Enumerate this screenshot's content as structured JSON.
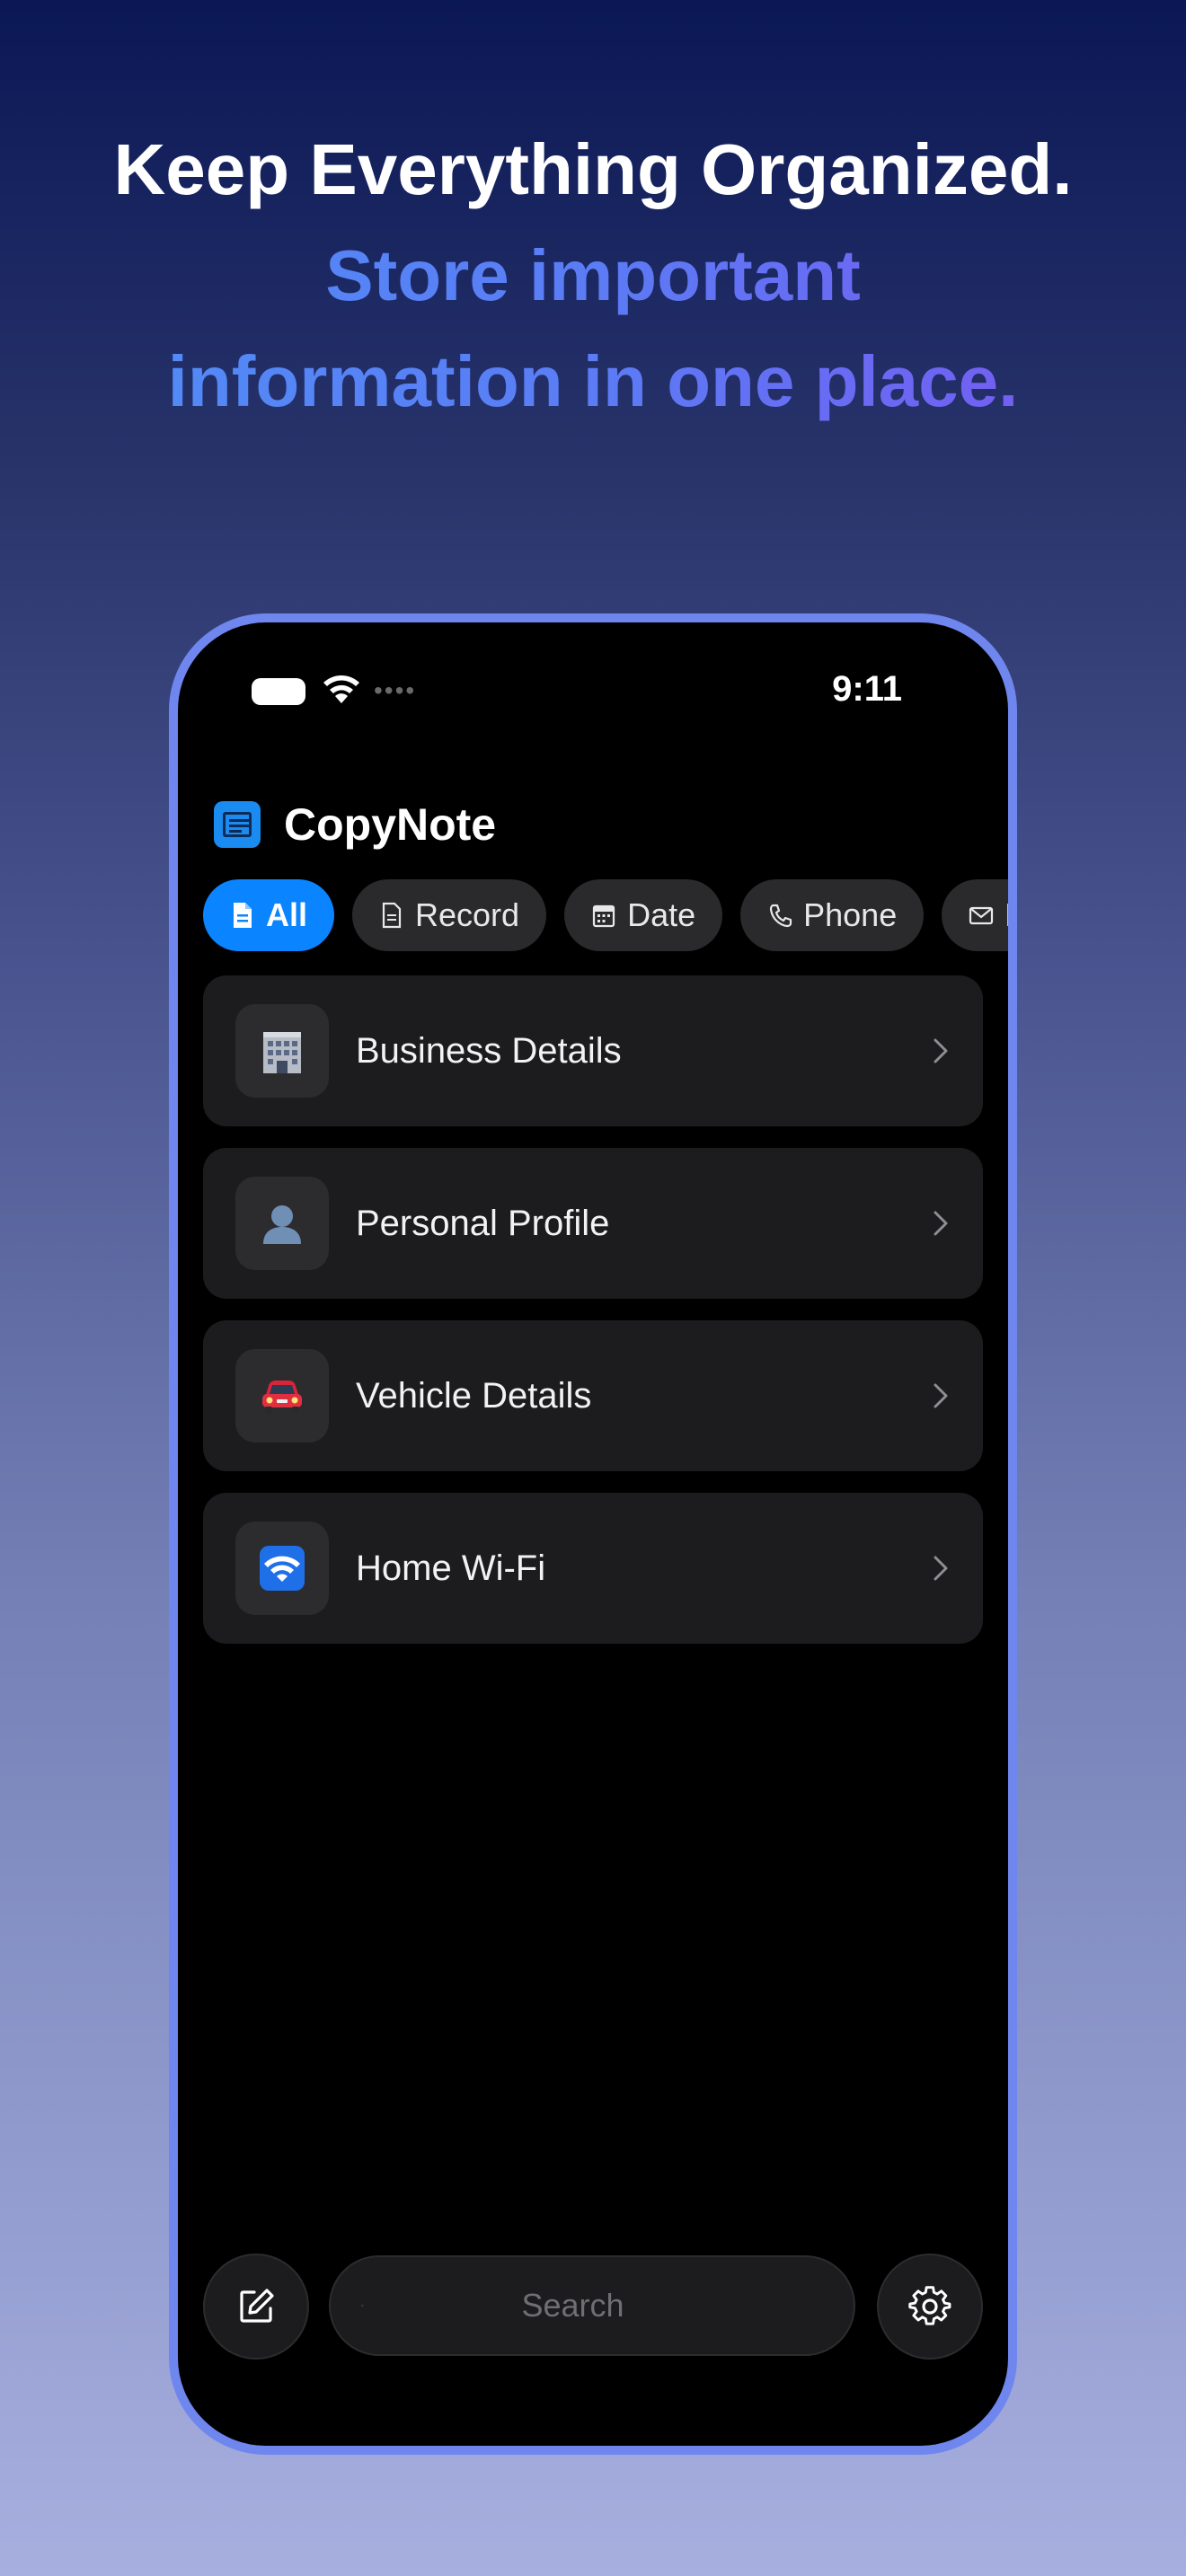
{
  "headline": {
    "line1": "Keep Everything Organized.",
    "line2": "Store important",
    "line3": "information in one place."
  },
  "status_bar": {
    "time": "9:11",
    "dots": "••••"
  },
  "app": {
    "title": "CopyNote"
  },
  "filters": [
    {
      "label": "All",
      "icon": "document-icon",
      "active": true
    },
    {
      "label": "Record",
      "icon": "record-icon",
      "active": false
    },
    {
      "label": "Date",
      "icon": "calendar-icon",
      "active": false
    },
    {
      "label": "Phone",
      "icon": "phone-icon",
      "active": false
    },
    {
      "label": "E",
      "icon": "envelope-icon",
      "active": false
    }
  ],
  "notes": [
    {
      "title": "Business Details",
      "emoji": "🏢",
      "icon": "office-building-icon"
    },
    {
      "title": "Personal Profile",
      "emoji": "👤",
      "icon": "person-silhouette-icon"
    },
    {
      "title": "Vehicle Details",
      "emoji": "🚘",
      "icon": "car-icon"
    },
    {
      "title": "Home Wi-Fi",
      "emoji": "📶",
      "icon": "wifi-icon"
    }
  ],
  "search": {
    "placeholder": "Search"
  },
  "colors": {
    "accent": "#0a84ff",
    "phone_frame": "#6f86ee",
    "card_bg": "#1c1c1e"
  }
}
